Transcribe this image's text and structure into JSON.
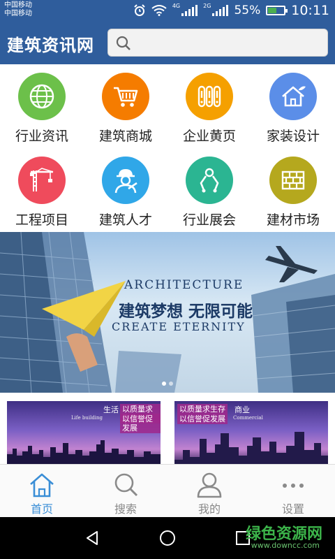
{
  "status_bar": {
    "carrier_1": "中国移动",
    "carrier_2": "中国移动",
    "net_1": "4G",
    "net_2": "2G",
    "battery": "55%",
    "battery_level": 0.55,
    "time": "10:11"
  },
  "header": {
    "title": "建筑资讯网",
    "search_placeholder": ""
  },
  "categories": [
    {
      "label": "行业资讯",
      "icon": "globe-icon",
      "color": "#6cc04a"
    },
    {
      "label": "建筑商城",
      "icon": "cart-icon",
      "color": "#f57c00"
    },
    {
      "label": "企业黄页",
      "icon": "pages-icon",
      "color": "#f5a000"
    },
    {
      "label": "家装设计",
      "icon": "house-icon",
      "color": "#5b8ee8"
    },
    {
      "label": "工程项目",
      "icon": "crane-icon",
      "color": "#ef4b5c"
    },
    {
      "label": "建筑人才",
      "icon": "worker-icon",
      "color": "#30a7e8"
    },
    {
      "label": "行业展会",
      "icon": "meeting-icon",
      "color": "#2bb592"
    },
    {
      "label": "建材市场",
      "icon": "bricks-icon",
      "color": "#b5a81e"
    }
  ],
  "banner": {
    "line1": "ARCHITECTURE",
    "line2": "建筑梦想 无限可能",
    "line3": "CREATE ETERNITY"
  },
  "ads": [
    {
      "tag": "生活",
      "en": "Life building",
      "line1": "以质量求生存",
      "line2": "以信誉促发展"
    },
    {
      "line1": "以质量求生存",
      "line2": "以信誉促发展",
      "tag": "商业",
      "en": "Commercial"
    }
  ],
  "tabs": [
    {
      "label": "首页",
      "icon": "home-icon",
      "active": true
    },
    {
      "label": "搜索",
      "icon": "search-icon",
      "active": false
    },
    {
      "label": "我的",
      "icon": "user-icon",
      "active": false
    },
    {
      "label": "设置",
      "icon": "more-icon",
      "active": false
    }
  ],
  "watermark": {
    "name": "绿色资源网",
    "url": "www.downcc.com"
  },
  "colors": {
    "header": "#2f5d9c",
    "tab_active": "#3a8ed6",
    "tab_inactive": "#888888"
  }
}
